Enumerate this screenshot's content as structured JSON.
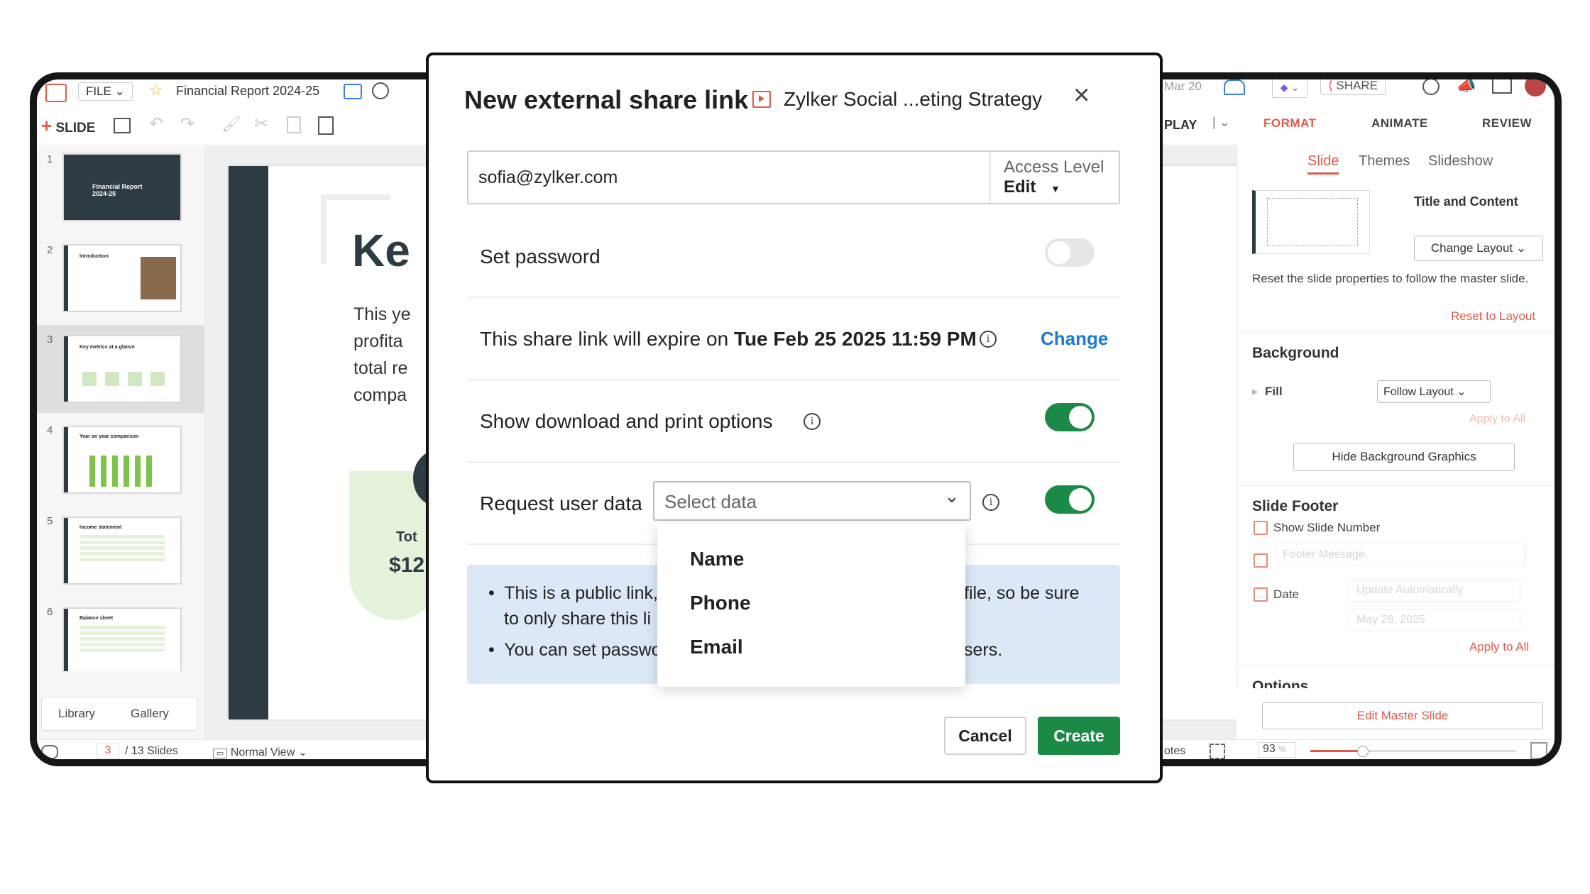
{
  "app": {
    "file_menu": "FILE",
    "doc_title": "Financial Report 2024-25",
    "add_slide": "SLIDE",
    "last_modified": "Mar 20",
    "share_button": "SHARE",
    "play_button": "PLAY",
    "thumbnails": [
      {
        "num": "1",
        "title": "Financial Report 2024-25"
      },
      {
        "num": "2",
        "title": "Introduction"
      },
      {
        "num": "3",
        "title": "Key metrics at a glance"
      },
      {
        "num": "4",
        "title": "Year on year comparison"
      },
      {
        "num": "5",
        "title": "Income statement"
      },
      {
        "num": "6",
        "title": "Balance sheet"
      }
    ],
    "library_tab": "Library",
    "gallery_tab": "Gallery",
    "slide_preview": {
      "heading_fragment": "Ke",
      "lines": [
        "This ye",
        "profita",
        "total re",
        "compa"
      ],
      "total_label": "Tot",
      "total_value": "$12"
    },
    "status_bar": {
      "current_slide": "3",
      "total_slides": "/ 13 Slides",
      "view_mode": "Normal View",
      "notes": "otes",
      "zoom": "93",
      "zoom_unit": "%"
    }
  },
  "format_panel": {
    "tabs": [
      "FORMAT",
      "ANIMATE",
      "REVIEW"
    ],
    "sub_tabs": [
      "Slide",
      "Themes",
      "Slideshow"
    ],
    "layout_name": "Title and Content",
    "change_layout": "Change Layout",
    "reset_note": "Reset the slide properties to follow the master slide.",
    "reset_link": "Reset to Layout",
    "background_title": "Background",
    "fill_label": "Fill",
    "fill_value": "Follow Layout",
    "apply_to_all_faded": "Apply to All",
    "hide_bg_button": "Hide Background Graphics",
    "footer_title": "Slide Footer",
    "show_slide_number": "Show Slide Number",
    "footer_message_placeholder": "Footer Message",
    "date_label": "Date",
    "date_mode": "Update Automatically",
    "date_value": "May 28, 2025",
    "apply_to_all": "Apply to All",
    "options_title": "Options",
    "edit_master": "Edit Master Slide"
  },
  "dialog": {
    "title": "New external share link",
    "doc_name": "Zylker Social ...eting Strategy",
    "email": "sofia@zylker.com",
    "access_label": "Access Level",
    "access_value": "Edit",
    "set_password": "Set password",
    "password_enabled": false,
    "expiry_prefix": "This share link will expire on ",
    "expiry_date": "Tue Feb 25 2025 11:59 PM",
    "change_link": "Change",
    "download_print": "Show download and print options",
    "download_enabled": true,
    "request_user_data": "Request user data",
    "select_placeholder": "Select data",
    "request_enabled": true,
    "dropdown_options": [
      "Name",
      "Phone",
      "Email"
    ],
    "notice_line1_a": "This is a public link,",
    "notice_line1_b": "file, so be sure",
    "notice_line1_c": "to only share this li",
    "notice_line2_a": "You can set passwo",
    "notice_line2_b": "sers.",
    "cancel": "Cancel",
    "create": "Create",
    "colors": {
      "accent_green": "#1b8a47",
      "link_blue": "#1a7ad6",
      "notice_bg": "#dce8f8",
      "brand_red": "#e05a4c"
    }
  }
}
